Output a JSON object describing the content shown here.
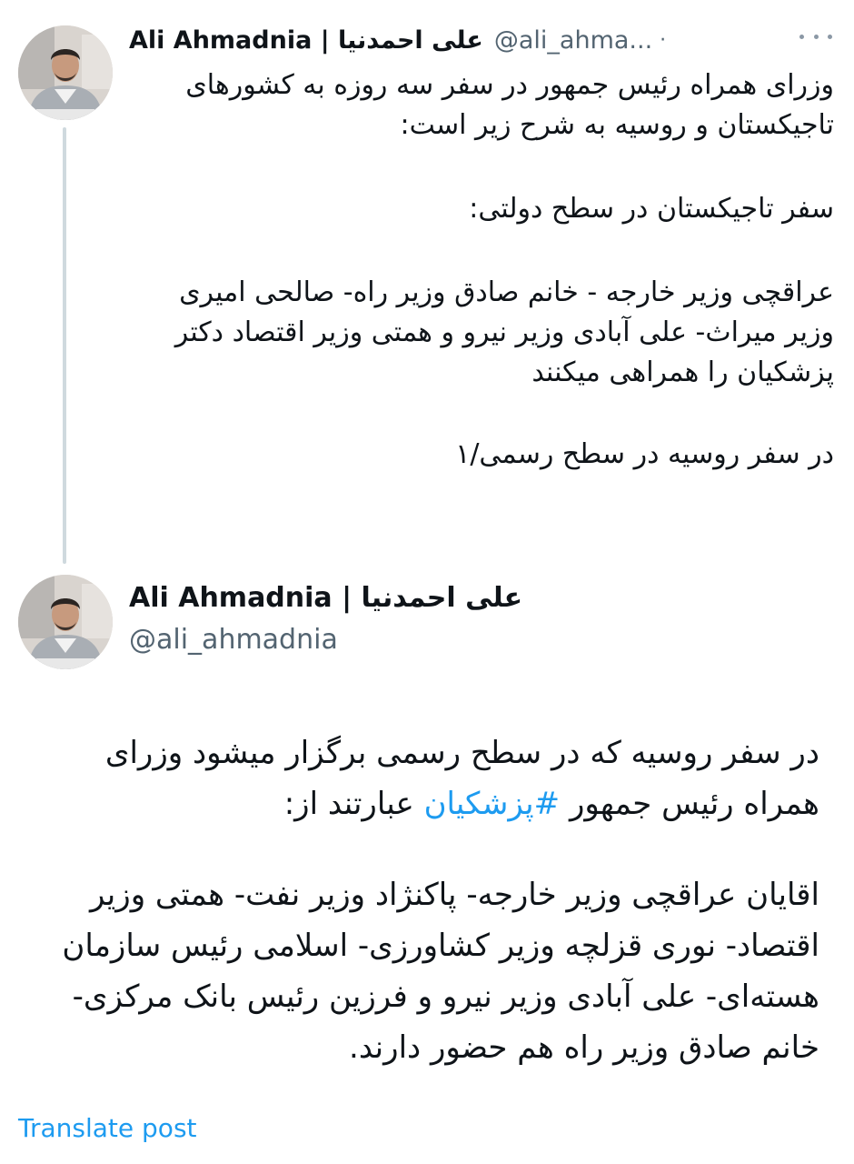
{
  "tweet1": {
    "display_name": "Ali Ahmadnia | علی احمدنیا",
    "handle": "@ali_ahma...",
    "separator": "·",
    "paragraphs": [
      "وزرای همراه رئیس جمهور در سفر سه روزه به کشورهای تاجیکستان و روسیه به شرح زیر است:",
      "سفر تاجیکستان در سطح دولتی:",
      "عراقچی وزیر خارجه - خانم صادق وزیر راه- صالحی امیری وزیر میراث- علی آبادی وزیر نیرو و همتی وزیر اقتصاد دکتر پزشکیان را همراهی میکنند",
      "در سفر روسیه در سطح رسمی/۱"
    ]
  },
  "tweet2": {
    "display_name": "Ali Ahmadnia | علی احمدنیا",
    "handle": "@ali_ahmadnia",
    "para1_before": "در سفر روسیه که در سطح رسمی برگزار میشود وزرای همراه رئیس جمهور ",
    "hashtag": "#پزشکیان",
    "para1_after": " عبارتند از:",
    "para2": "اقایان عراقچی وزیر خارجه- پاکنژاد وزیر نفت- همتی وزیر اقتصاد- نوری قزلچه وزیر کشاورزی- اسلامی رئیس سازمان هسته‌ای- علی آبادی وزیر نیرو و فرزین رئیس بانک مرکزی- خانم صادق وزیر راه هم حضور دارند."
  },
  "translate_label": "Translate post",
  "colors": {
    "link": "#1d9bf0",
    "secondary_text": "#536471",
    "thread_line": "#cfd9de"
  },
  "icons": [
    "avatar",
    "more-icon"
  ]
}
